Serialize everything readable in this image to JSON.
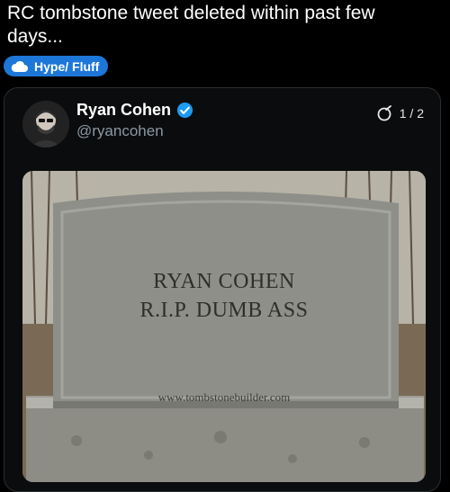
{
  "post": {
    "title": "RC tombstone tweet deleted within past few days...",
    "flair": "Hype/ Fluff",
    "flair_icon": "cloud-icon"
  },
  "tweet": {
    "author_name": "Ryan Cohen",
    "handle": "@ryancohen",
    "verified": true,
    "counter": "1 / 2",
    "image": {
      "line1": "RYAN COHEN",
      "line2": "R.I.P. DUMB ASS",
      "website": "www.tombstonebuilder.com"
    }
  },
  "colors": {
    "background": "#000000",
    "flair": "#1d77d8",
    "verified": "#1d9bf0",
    "handle": "#8b98a5"
  }
}
